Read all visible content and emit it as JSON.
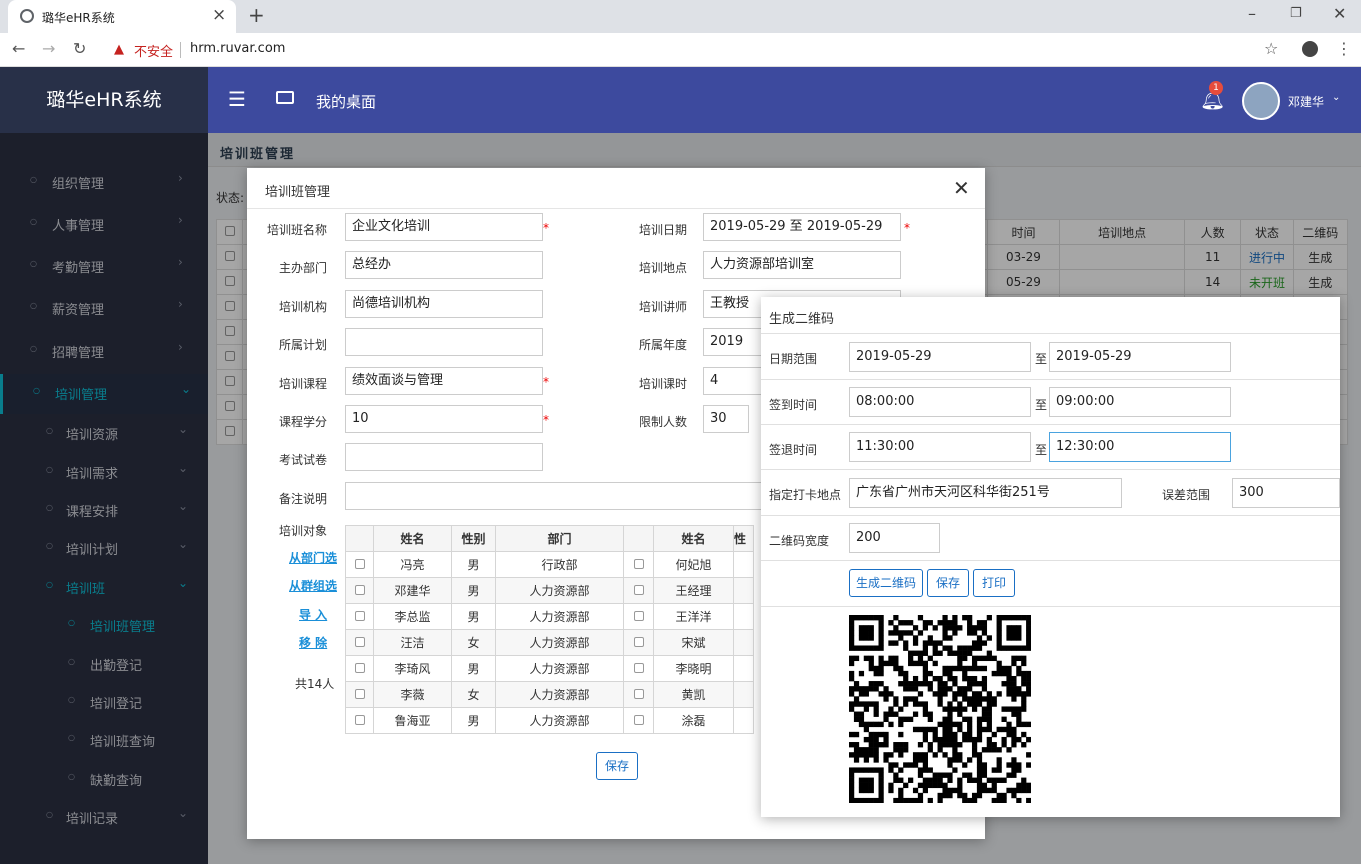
{
  "browser": {
    "tab_title": "璐华eHR系统",
    "insecure_label": "不安全",
    "url": "hrm.ruvar.com"
  },
  "app": {
    "brand": "璐华eHR系统",
    "desk_label": "我的桌面",
    "notif_count": "1",
    "user_name": "邓建华"
  },
  "sidebar": [
    {
      "label": "组织管理",
      "level": 0
    },
    {
      "label": "人事管理",
      "level": 0
    },
    {
      "label": "考勤管理",
      "level": 0
    },
    {
      "label": "薪资管理",
      "level": 0
    },
    {
      "label": "招聘管理",
      "level": 0
    },
    {
      "label": "培训管理",
      "level": 0,
      "active": true
    },
    {
      "label": "培训资源",
      "level": 1
    },
    {
      "label": "培训需求",
      "level": 1
    },
    {
      "label": "课程安排",
      "level": 1
    },
    {
      "label": "培训计划",
      "level": 1
    },
    {
      "label": "培训班",
      "level": 1,
      "active": true
    },
    {
      "label": "培训班管理",
      "level": 2,
      "active": true
    },
    {
      "label": "出勤登记",
      "level": 2
    },
    {
      "label": "培训登记",
      "level": 2
    },
    {
      "label": "培训班查询",
      "level": 2
    },
    {
      "label": "缺勤查询",
      "level": 2
    },
    {
      "label": "培训记录",
      "level": 1
    }
  ],
  "content": {
    "title": "培训班管理",
    "status_label": "状态:",
    "table_headers": [
      "时间",
      "培训地点",
      "人数",
      "状态",
      "二维码"
    ],
    "rows": [
      [
        "03-29",
        "",
        "11",
        "进行中",
        "生成"
      ],
      [
        "05-29",
        "",
        "14",
        "未开班",
        "生成"
      ]
    ]
  },
  "modal1": {
    "title": "培训班管理",
    "fields": {
      "name": {
        "label": "培训班名称",
        "value": "企业文化培训"
      },
      "dept": {
        "label": "主办部门",
        "value": "总经办"
      },
      "org": {
        "label": "培训机构",
        "value": "尚德培训机构"
      },
      "plan": {
        "label": "所属计划",
        "value": ""
      },
      "course": {
        "label": "培训课程",
        "value": "绩效面谈与管理"
      },
      "credit": {
        "label": "课程学分",
        "value": "10"
      },
      "exam": {
        "label": "考试试卷",
        "value": ""
      },
      "remark": {
        "label": "备注说明",
        "value": ""
      },
      "date": {
        "label": "培训日期",
        "value": "2019-05-29 至 2019-05-29"
      },
      "place": {
        "label": "培训地点",
        "value": "人力资源部培训室"
      },
      "teacher": {
        "label": "培训讲师",
        "value": "王教授"
      },
      "year": {
        "label": "所属年度",
        "value": "2019"
      },
      "hours": {
        "label": "培训课时",
        "value": "4"
      },
      "limit": {
        "label": "限制人数",
        "value": "30"
      }
    },
    "target_label": "培训对象",
    "links": [
      "从部门选",
      "从群组选",
      "导 入",
      "移 除"
    ],
    "total": "共14人",
    "table_headers": [
      "姓名",
      "性别",
      "部门",
      "姓名",
      "性"
    ],
    "rows": [
      [
        "冯亮",
        "男",
        "行政部",
        "何妃旭"
      ],
      [
        "邓建华",
        "男",
        "人力资源部",
        "王经理"
      ],
      [
        "李总监",
        "男",
        "人力资源部",
        "王洋洋"
      ],
      [
        "汪洁",
        "女",
        "人力资源部",
        "宋斌"
      ],
      [
        "李琦风",
        "男",
        "人力资源部",
        "李晓明"
      ],
      [
        "李薇",
        "女",
        "人力资源部",
        "黄凯"
      ],
      [
        "鲁海亚",
        "男",
        "人力资源部",
        "涂磊"
      ]
    ],
    "save": "保存"
  },
  "modal2": {
    "title": "生成二维码",
    "date_label": "日期范围",
    "date_from": "2019-05-29",
    "date_to": "2019-05-29",
    "signin_label": "签到时间",
    "signin_from": "08:00:00",
    "signin_to": "09:00:00",
    "signout_label": "签退时间",
    "signout_from": "11:30:00",
    "signout_to": "12:30:00",
    "to": "至",
    "addr_label": "指定打卡地点",
    "addr": "广东省广州市天河区科华街251号",
    "range_label": "误差范围",
    "range": "300",
    "width_label": "二维码宽度",
    "width": "200",
    "buttons": [
      "生成二维码",
      "保存",
      "打印"
    ]
  }
}
